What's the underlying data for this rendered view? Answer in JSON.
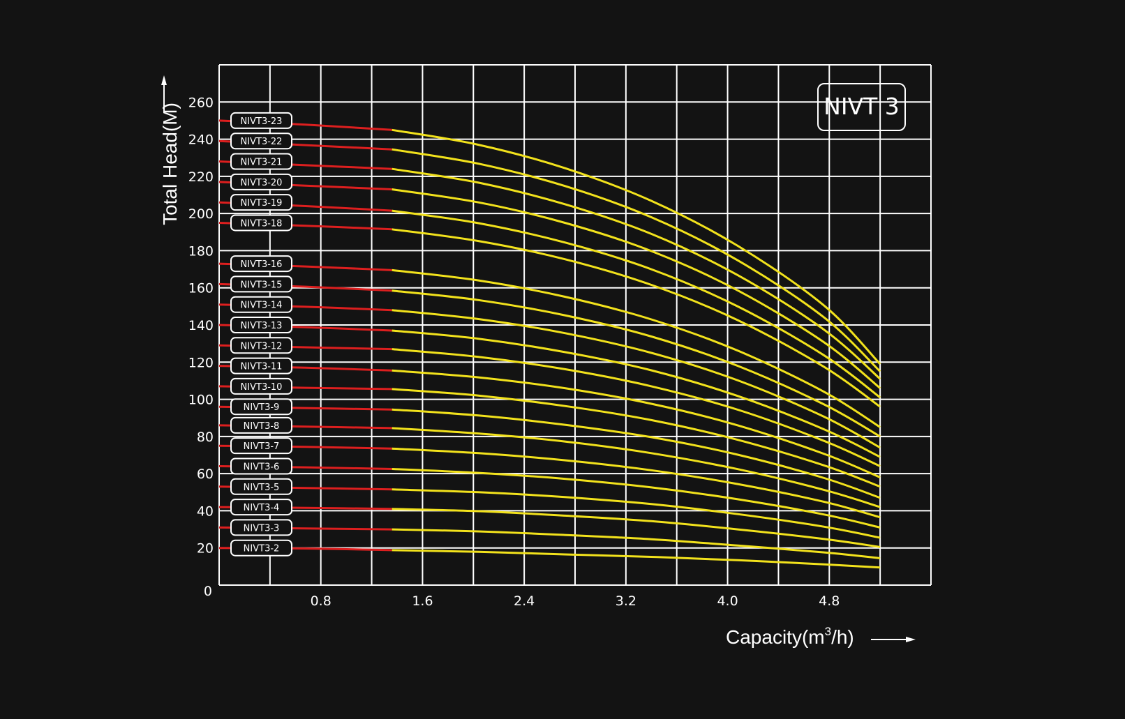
{
  "chart_data": {
    "type": "line",
    "title": "NIVT 3",
    "xlabel": {
      "prefix": "Capacity(m",
      "superscript": "3",
      "suffix": "/h)"
    },
    "ylabel": "Total Head(M)",
    "xlim": [
      0,
      5.6
    ],
    "ylim": [
      0,
      280
    ],
    "x_ticks": [
      {
        "value": 0.8,
        "label": "0.8"
      },
      {
        "value": 1.6,
        "label": "1.6"
      },
      {
        "value": 2.4,
        "label": "2.4"
      },
      {
        "value": 3.2,
        "label": "3.2"
      },
      {
        "value": 4.0,
        "label": "4.0"
      },
      {
        "value": 4.8,
        "label": "4.8"
      }
    ],
    "y_ticks": [
      {
        "value": 0,
        "label": "0"
      },
      {
        "value": 20,
        "label": "20"
      },
      {
        "value": 40,
        "label": "40"
      },
      {
        "value": 60,
        "label": "60"
      },
      {
        "value": 80,
        "label": "80"
      },
      {
        "value": 100,
        "label": "100"
      },
      {
        "value": 120,
        "label": "120"
      },
      {
        "value": 140,
        "label": "140"
      },
      {
        "value": 160,
        "label": "160"
      },
      {
        "value": 180,
        "label": "180"
      },
      {
        "value": 200,
        "label": "200"
      },
      {
        "value": 220,
        "label": "220"
      },
      {
        "value": 240,
        "label": "240"
      },
      {
        "value": 260,
        "label": "260"
      }
    ],
    "grid_x_step": 0.4,
    "grid_y_step": 20,
    "grid": true,
    "recommended_range_start": 1.36,
    "x": [
      0,
      0.68,
      1.36,
      2.04,
      2.72,
      3.4,
      4.08,
      4.76,
      5.2
    ],
    "colors": {
      "background": "#131313",
      "grid": "#ffffff",
      "low_flow_segment": "#dd1f1f",
      "operating_segment": "#f2e21c",
      "text": "#ffffff"
    },
    "series": [
      {
        "name": "NIVT3-2",
        "values": [
          20.0,
          19.7,
          18.8,
          17.9,
          16.5,
          15.2,
          13.4,
          11.2,
          9.5
        ]
      },
      {
        "name": "NIVT3-3",
        "values": [
          31.0,
          30.5,
          30.0,
          28.9,
          27.0,
          24.7,
          21.3,
          17.6,
          14.5
        ]
      },
      {
        "name": "NIVT3-4",
        "values": [
          42.0,
          41.6,
          41.0,
          39.8,
          37.4,
          34.4,
          30.0,
          24.8,
          20.5
        ]
      },
      {
        "name": "NIVT3-5",
        "values": [
          53.0,
          52.3,
          51.5,
          50.0,
          47.4,
          43.6,
          38.2,
          31.4,
          25.5
        ]
      },
      {
        "name": "NIVT3-6",
        "values": [
          64.0,
          63.4,
          62.5,
          60.4,
          57.2,
          52.6,
          46.2,
          38.0,
          31.0
        ]
      },
      {
        "name": "NIVT3-7",
        "values": [
          75.0,
          74.4,
          73.5,
          71.0,
          67.2,
          61.8,
          54.4,
          44.8,
          36.5
        ]
      },
      {
        "name": "NIVT3-8",
        "values": [
          86.0,
          85.3,
          84.5,
          81.6,
          77.3,
          71.0,
          62.4,
          51.2,
          42.0
        ]
      },
      {
        "name": "NIVT3-9",
        "values": [
          96.0,
          95.3,
          94.5,
          91.3,
          86.3,
          79.6,
          70.2,
          57.6,
          47.0
        ]
      },
      {
        "name": "NIVT3-10",
        "values": [
          107.0,
          106.2,
          105.5,
          102.0,
          96.4,
          88.8,
          78.2,
          64.4,
          53.0
        ]
      },
      {
        "name": "NIVT3-11",
        "values": [
          118.0,
          117.0,
          115.5,
          111.8,
          106.0,
          97.6,
          86.0,
          70.6,
          58.0
        ]
      },
      {
        "name": "NIVT3-12",
        "values": [
          129.0,
          128.0,
          127.0,
          122.8,
          116.2,
          107.0,
          94.4,
          77.6,
          64.0
        ]
      },
      {
        "name": "NIVT3-13",
        "values": [
          140.0,
          138.8,
          137.0,
          132.6,
          125.4,
          115.6,
          101.8,
          83.8,
          69.0
        ]
      },
      {
        "name": "NIVT3-14",
        "values": [
          151.0,
          149.8,
          148.0,
          143.2,
          135.6,
          125.0,
          110.2,
          90.6,
          74.0
        ]
      },
      {
        "name": "NIVT3-15",
        "values": [
          162.0,
          160.6,
          158.5,
          153.4,
          145.2,
          133.8,
          118.0,
          97.2,
          80.0
        ]
      },
      {
        "name": "NIVT3-16",
        "values": [
          173.0,
          171.5,
          169.5,
          164.0,
          155.2,
          143.0,
          126.2,
          104.0,
          85.0
        ]
      },
      {
        "name": "NIVT3-18",
        "values": [
          195.0,
          193.4,
          191.5,
          185.2,
          175.4,
          161.6,
          142.6,
          117.4,
          96.0
        ]
      },
      {
        "name": "NIVT3-19",
        "values": [
          206.0,
          204.0,
          201.5,
          194.8,
          184.4,
          170.0,
          150.0,
          123.6,
          101.0
        ]
      },
      {
        "name": "NIVT3-20",
        "values": [
          217.0,
          215.0,
          213.0,
          206.0,
          195.0,
          179.8,
          158.6,
          130.6,
          106.0
        ]
      },
      {
        "name": "NIVT3-21",
        "values": [
          228.0,
          226.0,
          224.0,
          216.6,
          205.0,
          189.0,
          166.8,
          137.4,
          111.0
        ]
      },
      {
        "name": "NIVT3-22",
        "values": [
          239.0,
          236.8,
          234.5,
          226.8,
          214.8,
          198.0,
          174.8,
          144.0,
          115.0
        ]
      },
      {
        "name": "NIVT3-23",
        "values": [
          250.0,
          247.8,
          245.0,
          237.0,
          224.4,
          206.8,
          182.6,
          150.4,
          119.0
        ]
      }
    ]
  }
}
